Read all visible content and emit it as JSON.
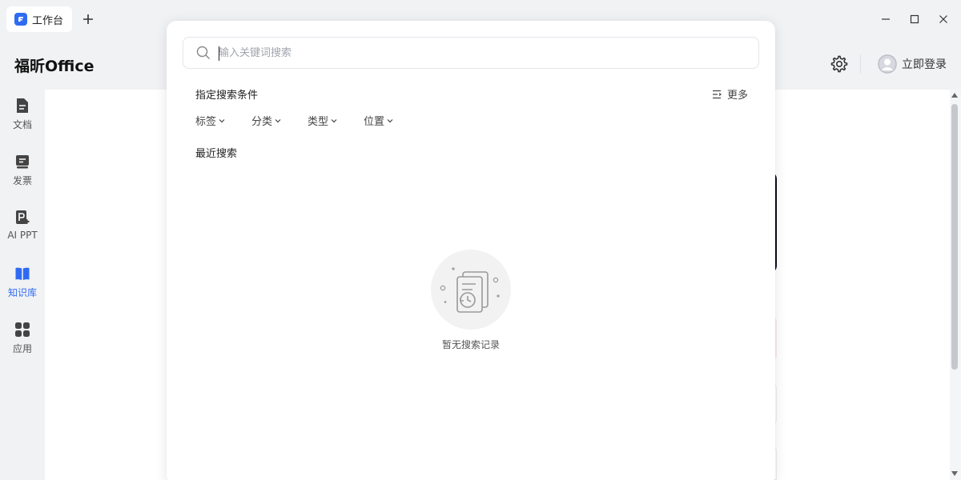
{
  "titlebar": {
    "tab_label": "工作台",
    "add_tab_icon": "plus-icon",
    "window_controls": [
      "minimize-icon",
      "maximize-icon",
      "close-icon"
    ]
  },
  "header": {
    "brand": "福昕Office",
    "settings_icon": "gear-icon",
    "login_label": "立即登录"
  },
  "sidebar": {
    "items": [
      {
        "label": "文档",
        "icon": "document-icon",
        "active": false
      },
      {
        "label": "发票",
        "icon": "invoice-icon",
        "active": false
      },
      {
        "label": "AI PPT",
        "icon": "ai-ppt-icon",
        "active": false
      },
      {
        "label": "知识库",
        "icon": "knowledge-base-icon",
        "active": true
      },
      {
        "label": "应用",
        "icon": "apps-icon",
        "active": false
      }
    ]
  },
  "search": {
    "placeholder": "输入关键词搜索",
    "value": "",
    "conditions_title": "指定搜索条件",
    "more_label": "更多",
    "filters": [
      "标签",
      "分类",
      "类型",
      "位置"
    ],
    "recent_title": "最近搜索",
    "empty_text": "暂无搜索记录"
  },
  "colors": {
    "accent": "#2f6bf2",
    "background": "#f1f2f4",
    "panel": "#ffffff"
  }
}
